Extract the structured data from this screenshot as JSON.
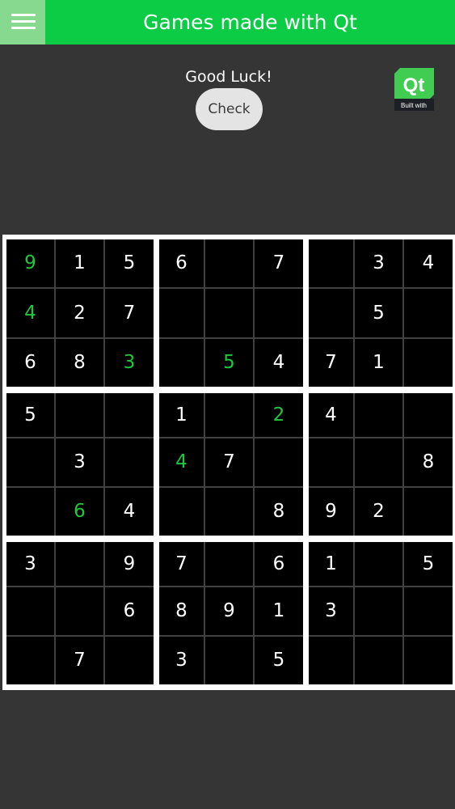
{
  "app": {
    "title": "Games made with Qt"
  },
  "icons": {
    "menu": "hamburger-menu-icon",
    "logo": "qt-built-with-logo"
  },
  "colors": {
    "header_bg": "#0ccc46",
    "menu_bg": "#87d98f",
    "background": "#353535",
    "board_border": "#ffffff",
    "cell_bg": "#000000",
    "given_digit": "#ffffff",
    "entered_digit": "#1ec83c",
    "button_bg": "#e4e4e4",
    "qt_green": "#41cd52"
  },
  "status": {
    "message": "Good Luck!"
  },
  "controls": {
    "check_label": "Check"
  },
  "logo": {
    "main_text": "Qt",
    "sub_text": "Built with"
  },
  "board": {
    "rows": [
      [
        "9",
        "1",
        "5",
        "6",
        "",
        "7",
        "",
        "3",
        "4"
      ],
      [
        "4",
        "2",
        "7",
        "",
        "",
        "",
        "",
        "5",
        ""
      ],
      [
        "6",
        "8",
        "3",
        "",
        "5",
        "4",
        "7",
        "1",
        ""
      ],
      [
        "5",
        "",
        "",
        "1",
        "",
        "2",
        "4",
        "",
        ""
      ],
      [
        "",
        "3",
        "",
        "4",
        "7",
        "",
        "",
        "",
        "8"
      ],
      [
        "",
        "6",
        "4",
        "",
        "",
        "8",
        "9",
        "2",
        ""
      ],
      [
        "3",
        "",
        "9",
        "7",
        "",
        "6",
        "1",
        "",
        "5"
      ],
      [
        "",
        "",
        "6",
        "8",
        "9",
        "1",
        "3",
        "",
        ""
      ],
      [
        "",
        "7",
        "",
        "3",
        "",
        "5",
        "",
        "",
        ""
      ]
    ],
    "entered": [
      [
        true,
        false,
        false,
        false,
        false,
        false,
        false,
        false,
        false
      ],
      [
        true,
        false,
        false,
        false,
        false,
        false,
        false,
        false,
        false
      ],
      [
        false,
        false,
        true,
        false,
        true,
        false,
        false,
        false,
        false
      ],
      [
        false,
        false,
        false,
        false,
        false,
        true,
        false,
        false,
        false
      ],
      [
        false,
        false,
        false,
        true,
        false,
        false,
        false,
        false,
        false
      ],
      [
        false,
        true,
        false,
        false,
        false,
        false,
        false,
        false,
        false
      ],
      [
        false,
        false,
        false,
        false,
        false,
        false,
        false,
        false,
        false
      ],
      [
        false,
        false,
        false,
        false,
        false,
        false,
        false,
        false,
        false
      ],
      [
        false,
        false,
        false,
        false,
        false,
        false,
        false,
        false,
        false
      ]
    ]
  }
}
